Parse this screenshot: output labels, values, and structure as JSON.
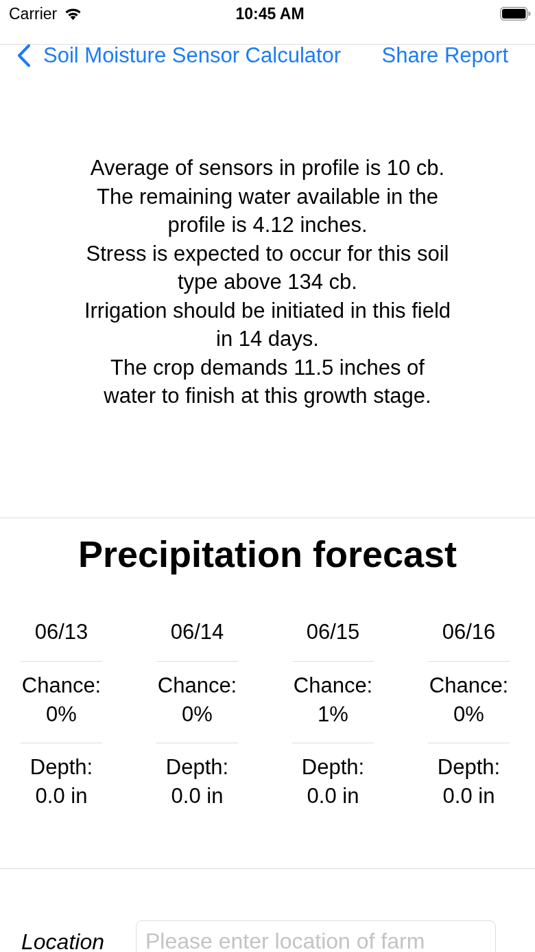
{
  "status_bar": {
    "carrier": "Carrier",
    "time": "10:45 AM"
  },
  "nav_bar": {
    "back_label": "Soil Moisture Sensor Calculator",
    "action": "Share Report"
  },
  "summary": {
    "sentences": [
      "Average of sensors in profile is 10 cb.",
      "The remaining water available in the profile is 4.12 inches.",
      "Stress is expected to occur for this soil type above 134 cb.",
      "Irrigation should be initiated in this field in 14 days.",
      "The crop demands 11.5 inches of water to finish at this growth stage."
    ]
  },
  "forecast": {
    "title": "Precipitation forecast",
    "days": [
      {
        "date": "06/13",
        "chance_label": "Chance:",
        "chance": "0%",
        "depth_label": "Depth:",
        "depth": "0.0 in"
      },
      {
        "date": "06/14",
        "chance_label": "Chance:",
        "chance": "0%",
        "depth_label": "Depth:",
        "depth": "0.0 in"
      },
      {
        "date": "06/15",
        "chance_label": "Chance:",
        "chance": "1%",
        "depth_label": "Depth:",
        "depth": "0.0 in"
      },
      {
        "date": "06/16",
        "chance_label": "Chance:",
        "chance": "0%",
        "depth_label": "Depth:",
        "depth": "0.0 in"
      }
    ]
  },
  "location": {
    "label": "Location",
    "placeholder": "Please enter location of farm"
  }
}
